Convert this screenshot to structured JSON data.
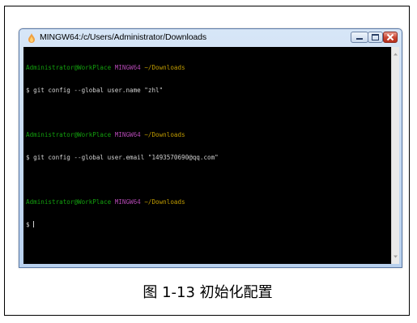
{
  "window": {
    "title": "MINGW64:/c/Users/Administrator/Downloads"
  },
  "terminal": {
    "prompts": [
      {
        "user_host": "Administrator@WorkPlace",
        "shell": "MINGW64",
        "path": "~/Downloads",
        "command": "$ git config --global user.name \"zhl\""
      },
      {
        "user_host": "Administrator@WorkPlace",
        "shell": "MINGW64",
        "path": "~/Downloads",
        "command": "$ git config --global user.email \"1493570690@qq.com\""
      },
      {
        "user_host": "Administrator@WorkPlace",
        "shell": "MINGW64",
        "path": "~/Downloads",
        "command": "$ "
      }
    ],
    "colors": {
      "background": "#000000",
      "user_host": "#13a10e",
      "shell": "#b248b2",
      "path": "#c19c00",
      "text": "#d0d0d0"
    }
  },
  "caption": "图 1-13  初始化配置",
  "icons": [
    "mingw-app-icon",
    "minimize-icon",
    "maximize-icon",
    "close-icon",
    "scroll-up-icon",
    "scroll-down-icon"
  ]
}
